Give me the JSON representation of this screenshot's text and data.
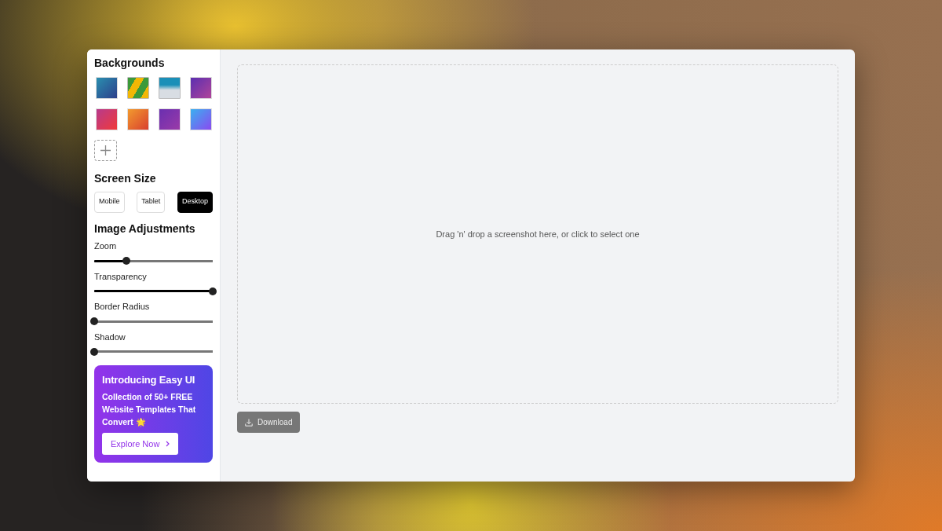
{
  "sidebar": {
    "backgrounds_title": "Backgrounds",
    "backgrounds": [
      {
        "kind": "gradient"
      },
      {
        "kind": "photo"
      },
      {
        "kind": "photo"
      },
      {
        "kind": "gradient"
      },
      {
        "kind": "gradient"
      },
      {
        "kind": "gradient"
      },
      {
        "kind": "gradient"
      },
      {
        "kind": "gradient"
      }
    ],
    "screen_size_title": "Screen Size",
    "screen_sizes": [
      {
        "label": "Mobile",
        "selected": false
      },
      {
        "label": "Tablet",
        "selected": false
      },
      {
        "label": "Desktop",
        "selected": true
      }
    ],
    "adjustments_title": "Image Adjustments",
    "sliders": [
      {
        "label": "Zoom",
        "level": 0.27
      },
      {
        "label": "Transparency",
        "level": 1
      },
      {
        "label": "Border Radius",
        "level": 0
      },
      {
        "label": "Shadow",
        "level": 0
      }
    ],
    "promo": {
      "title": "Introducing Easy UI",
      "text": "Collection of 50+ FREE Website Templates That Convert 🌟",
      "button": "Explore Now"
    }
  },
  "dropzone": {
    "text": "Drag 'n' drop a screenshot here, or click to select one"
  },
  "download_button": "Download"
}
